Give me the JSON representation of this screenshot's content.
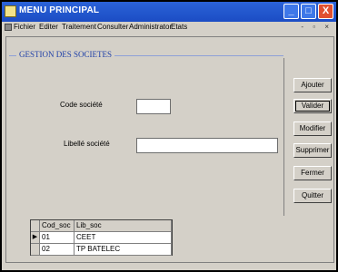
{
  "window": {
    "title": "MENU PRINCIPAL",
    "min_glyph": "_",
    "max_glyph": "□",
    "close_glyph": "X"
  },
  "menu": {
    "items": [
      "Fichier",
      "Editer",
      "Traitement",
      "Consulter",
      "Administrator",
      "Etats"
    ],
    "mdi_controls": "- ▫ ×"
  },
  "form": {
    "group_title": "GESTION DES SOCIETES",
    "code_label": "Code société",
    "code_value": "",
    "libelle_label": "Libellé société",
    "libelle_value": ""
  },
  "actions": {
    "ajouter": "Ajouter",
    "valider": "Valider",
    "modifier": "Modifier",
    "supprimer": "Supprimer",
    "fermer": "Fermer",
    "quitter": "Quitter"
  },
  "grid": {
    "columns": [
      "Cod_soc",
      "Lib_soc"
    ],
    "current_row_marker": "▶",
    "rows": [
      {
        "cod_soc": "01",
        "lib_soc": "CEET"
      },
      {
        "cod_soc": "02",
        "lib_soc": "TP BATELEC"
      }
    ]
  }
}
